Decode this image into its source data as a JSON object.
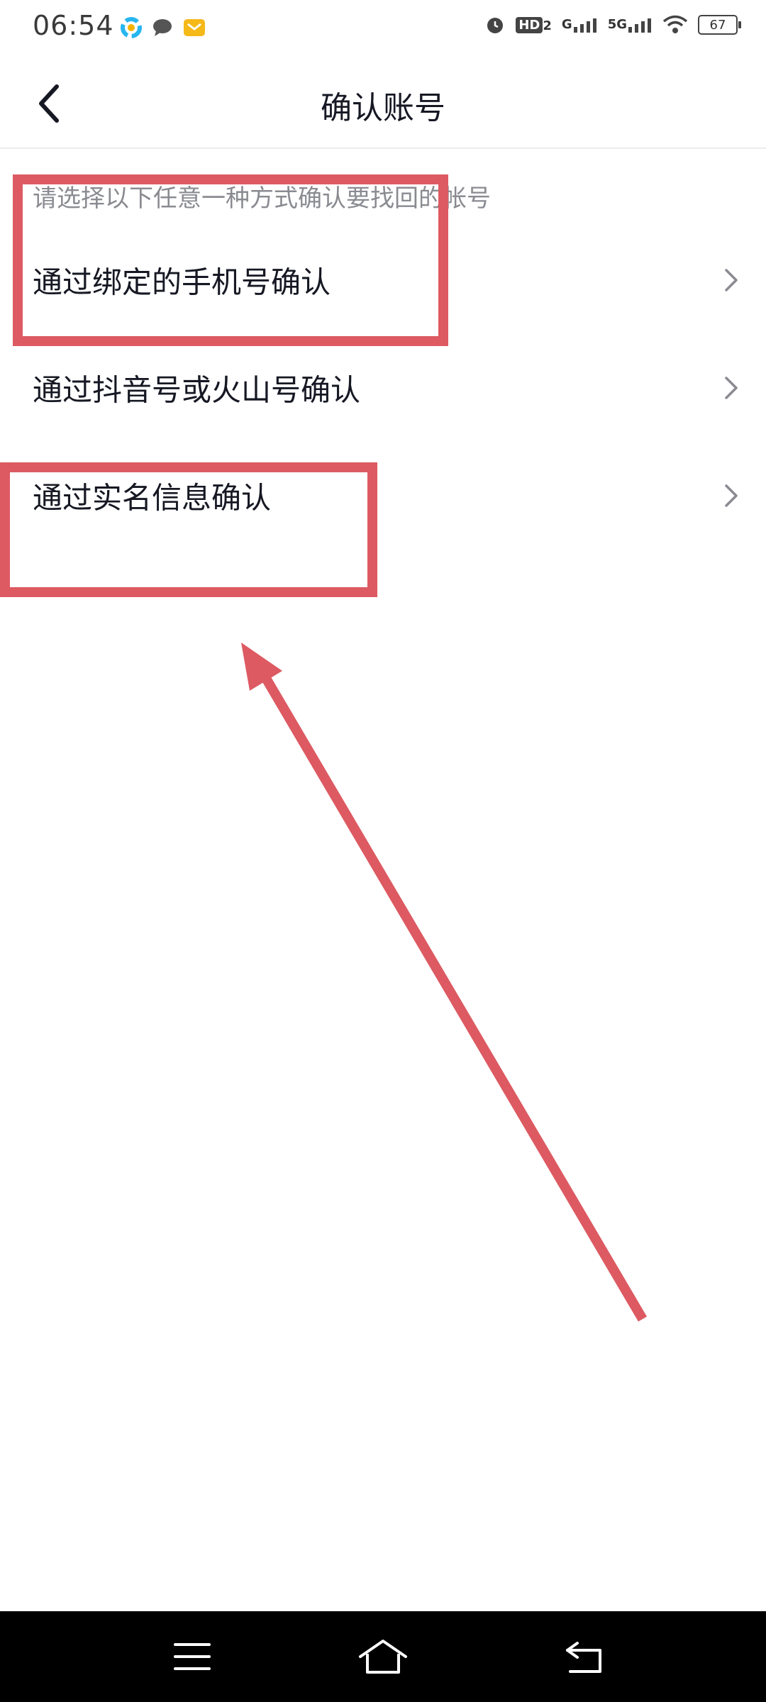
{
  "status_bar": {
    "time": "06:54",
    "notification_icons": [
      "app-icon",
      "message-icon",
      "mail-icon"
    ],
    "right_icons": [
      "alarm-icon",
      "hd-icon",
      "signal-icon",
      "5g-signal-icon",
      "wifi-icon"
    ],
    "hd_label": "HD",
    "hd_sub": "2",
    "g_label": "G",
    "fiveg_label": "5G",
    "battery": "67"
  },
  "nav": {
    "title": "确认账号",
    "back_icon": "chevron-left-icon"
  },
  "content": {
    "hint": "请选择以下任意一种方式确认要找回的帐号",
    "options": [
      {
        "label": "通过绑定的手机号确认",
        "icon": "chevron-right-icon"
      },
      {
        "label": "通过抖音号或火山号确认",
        "icon": "chevron-right-icon"
      },
      {
        "label": "通过实名信息确认",
        "icon": "chevron-right-icon"
      }
    ]
  },
  "annotations": {
    "color": "#dd5a62"
  },
  "system_nav": {
    "buttons": [
      "menu-icon",
      "home-icon",
      "back-icon"
    ]
  }
}
